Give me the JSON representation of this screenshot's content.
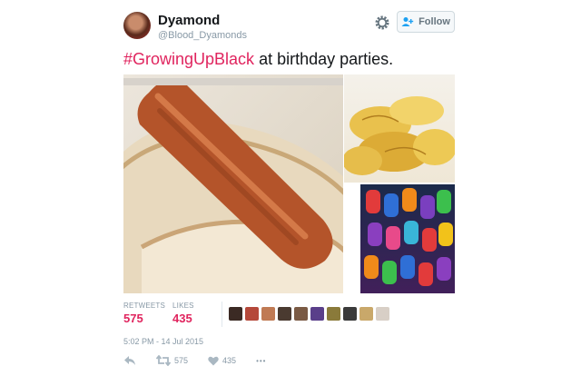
{
  "tweet": {
    "display_name": "Dyamond",
    "handle": "@Blood_Dyamonds",
    "follow_label": "Follow",
    "hashtag": "#GrowingUpBlack",
    "text": " at birthday parties.",
    "timestamp": "5:02 PM - 14 Jul 2015"
  },
  "stats": {
    "retweets_label": "RETWEETS",
    "retweets_value": "575",
    "likes_label": "LIKES",
    "likes_value": "435"
  },
  "actions": {
    "retweet_count": "575",
    "like_count": "435",
    "more_label": "•••"
  },
  "colors": {
    "accent": "#e0245e",
    "muted": "#8899a6"
  },
  "icons": [
    "gear-icon",
    "follow-person-icon",
    "reply-icon",
    "retweet-icon",
    "like-heart-icon",
    "more-icon"
  ]
}
